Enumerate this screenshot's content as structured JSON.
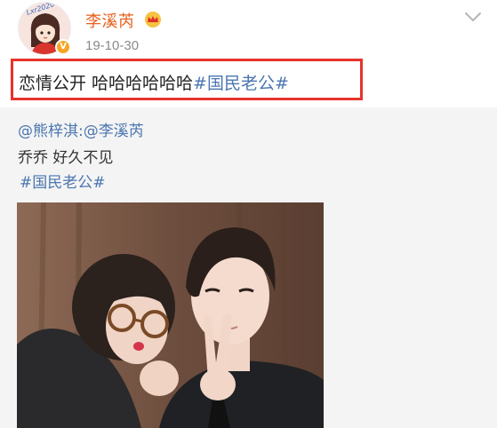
{
  "post": {
    "author": {
      "name": "李溪芮",
      "avatar_icon": "avatar-cartoon-icon",
      "avatar_text": "Lxr2020",
      "verified_icon": "verified-badge-icon",
      "verified_glyph": "V",
      "crown_icon": "crown-icon"
    },
    "time": "19-10-30",
    "text": "恋情公开 哈哈哈哈哈哈",
    "hashtag": "#国民老公#",
    "highlight_color": "#e8332b",
    "menu_icon": "chevron-down-icon"
  },
  "repost": {
    "author_mention": "@熊梓淇",
    "separator": ":",
    "reply_mention": "@李溪芮",
    "text": "乔乔 好久不见",
    "hashtag": "#国民老公#",
    "image_icon": "selfie-photo"
  },
  "colors": {
    "username": "#e8601c",
    "link": "#4b76b0",
    "repost_bg": "#f4f4f4"
  }
}
